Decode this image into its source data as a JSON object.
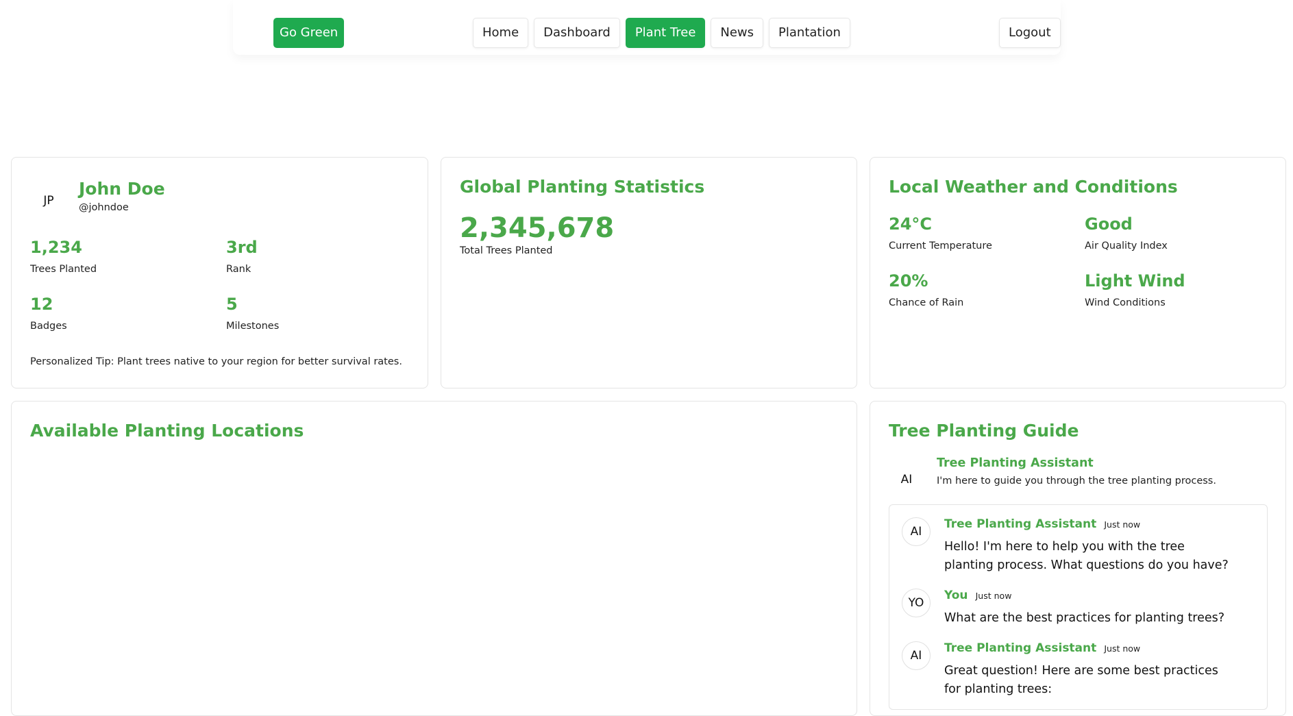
{
  "nav": {
    "brand": "Go Green",
    "links": [
      {
        "label": "Home",
        "active": false
      },
      {
        "label": "Dashboard",
        "active": false
      },
      {
        "label": "Plant Tree",
        "active": true
      },
      {
        "label": "News",
        "active": false
      },
      {
        "label": "Plantation",
        "active": false
      }
    ],
    "logout": "Logout"
  },
  "profile": {
    "initials": "JP",
    "name": "John Doe",
    "handle": "@johndoe",
    "stats": [
      {
        "value": "1,234",
        "label": "Trees Planted"
      },
      {
        "value": "3rd",
        "label": "Rank"
      },
      {
        "value": "12",
        "label": "Badges"
      },
      {
        "value": "5",
        "label": "Milestones"
      }
    ],
    "tip": "Personalized Tip: Plant trees native to your region for better survival rates."
  },
  "global_stats": {
    "title": "Global Planting Statistics",
    "total": "2,345,678",
    "total_label": "Total Trees Planted"
  },
  "weather": {
    "title": "Local Weather and Conditions",
    "items": [
      {
        "value": "24°C",
        "label": "Current Temperature"
      },
      {
        "value": "Good",
        "label": "Air Quality Index"
      },
      {
        "value": "20%",
        "label": "Chance of Rain"
      },
      {
        "value": "Light Wind",
        "label": "Wind Conditions"
      }
    ]
  },
  "locations": {
    "title": "Available Planting Locations"
  },
  "guide": {
    "title": "Tree Planting Guide",
    "assistant_initials": "AI",
    "assistant_name": "Tree Planting Assistant",
    "assistant_sub": "I'm here to guide you through the tree planting process.",
    "messages": [
      {
        "initials": "AI",
        "sender": "Tree Planting Assistant",
        "time": "Just now",
        "text": "Hello! I'm here to help you with the tree planting process. What questions do you have?"
      },
      {
        "initials": "YO",
        "sender": "You",
        "time": "Just now",
        "text": "What are the best practices for planting trees?"
      },
      {
        "initials": "AI",
        "sender": "Tree Planting Assistant",
        "time": "Just now",
        "text": "Great question! Here are some best practices for planting trees:"
      }
    ]
  },
  "colors": {
    "accent": "#1faa4f",
    "heading_green": "#4aa84a"
  }
}
